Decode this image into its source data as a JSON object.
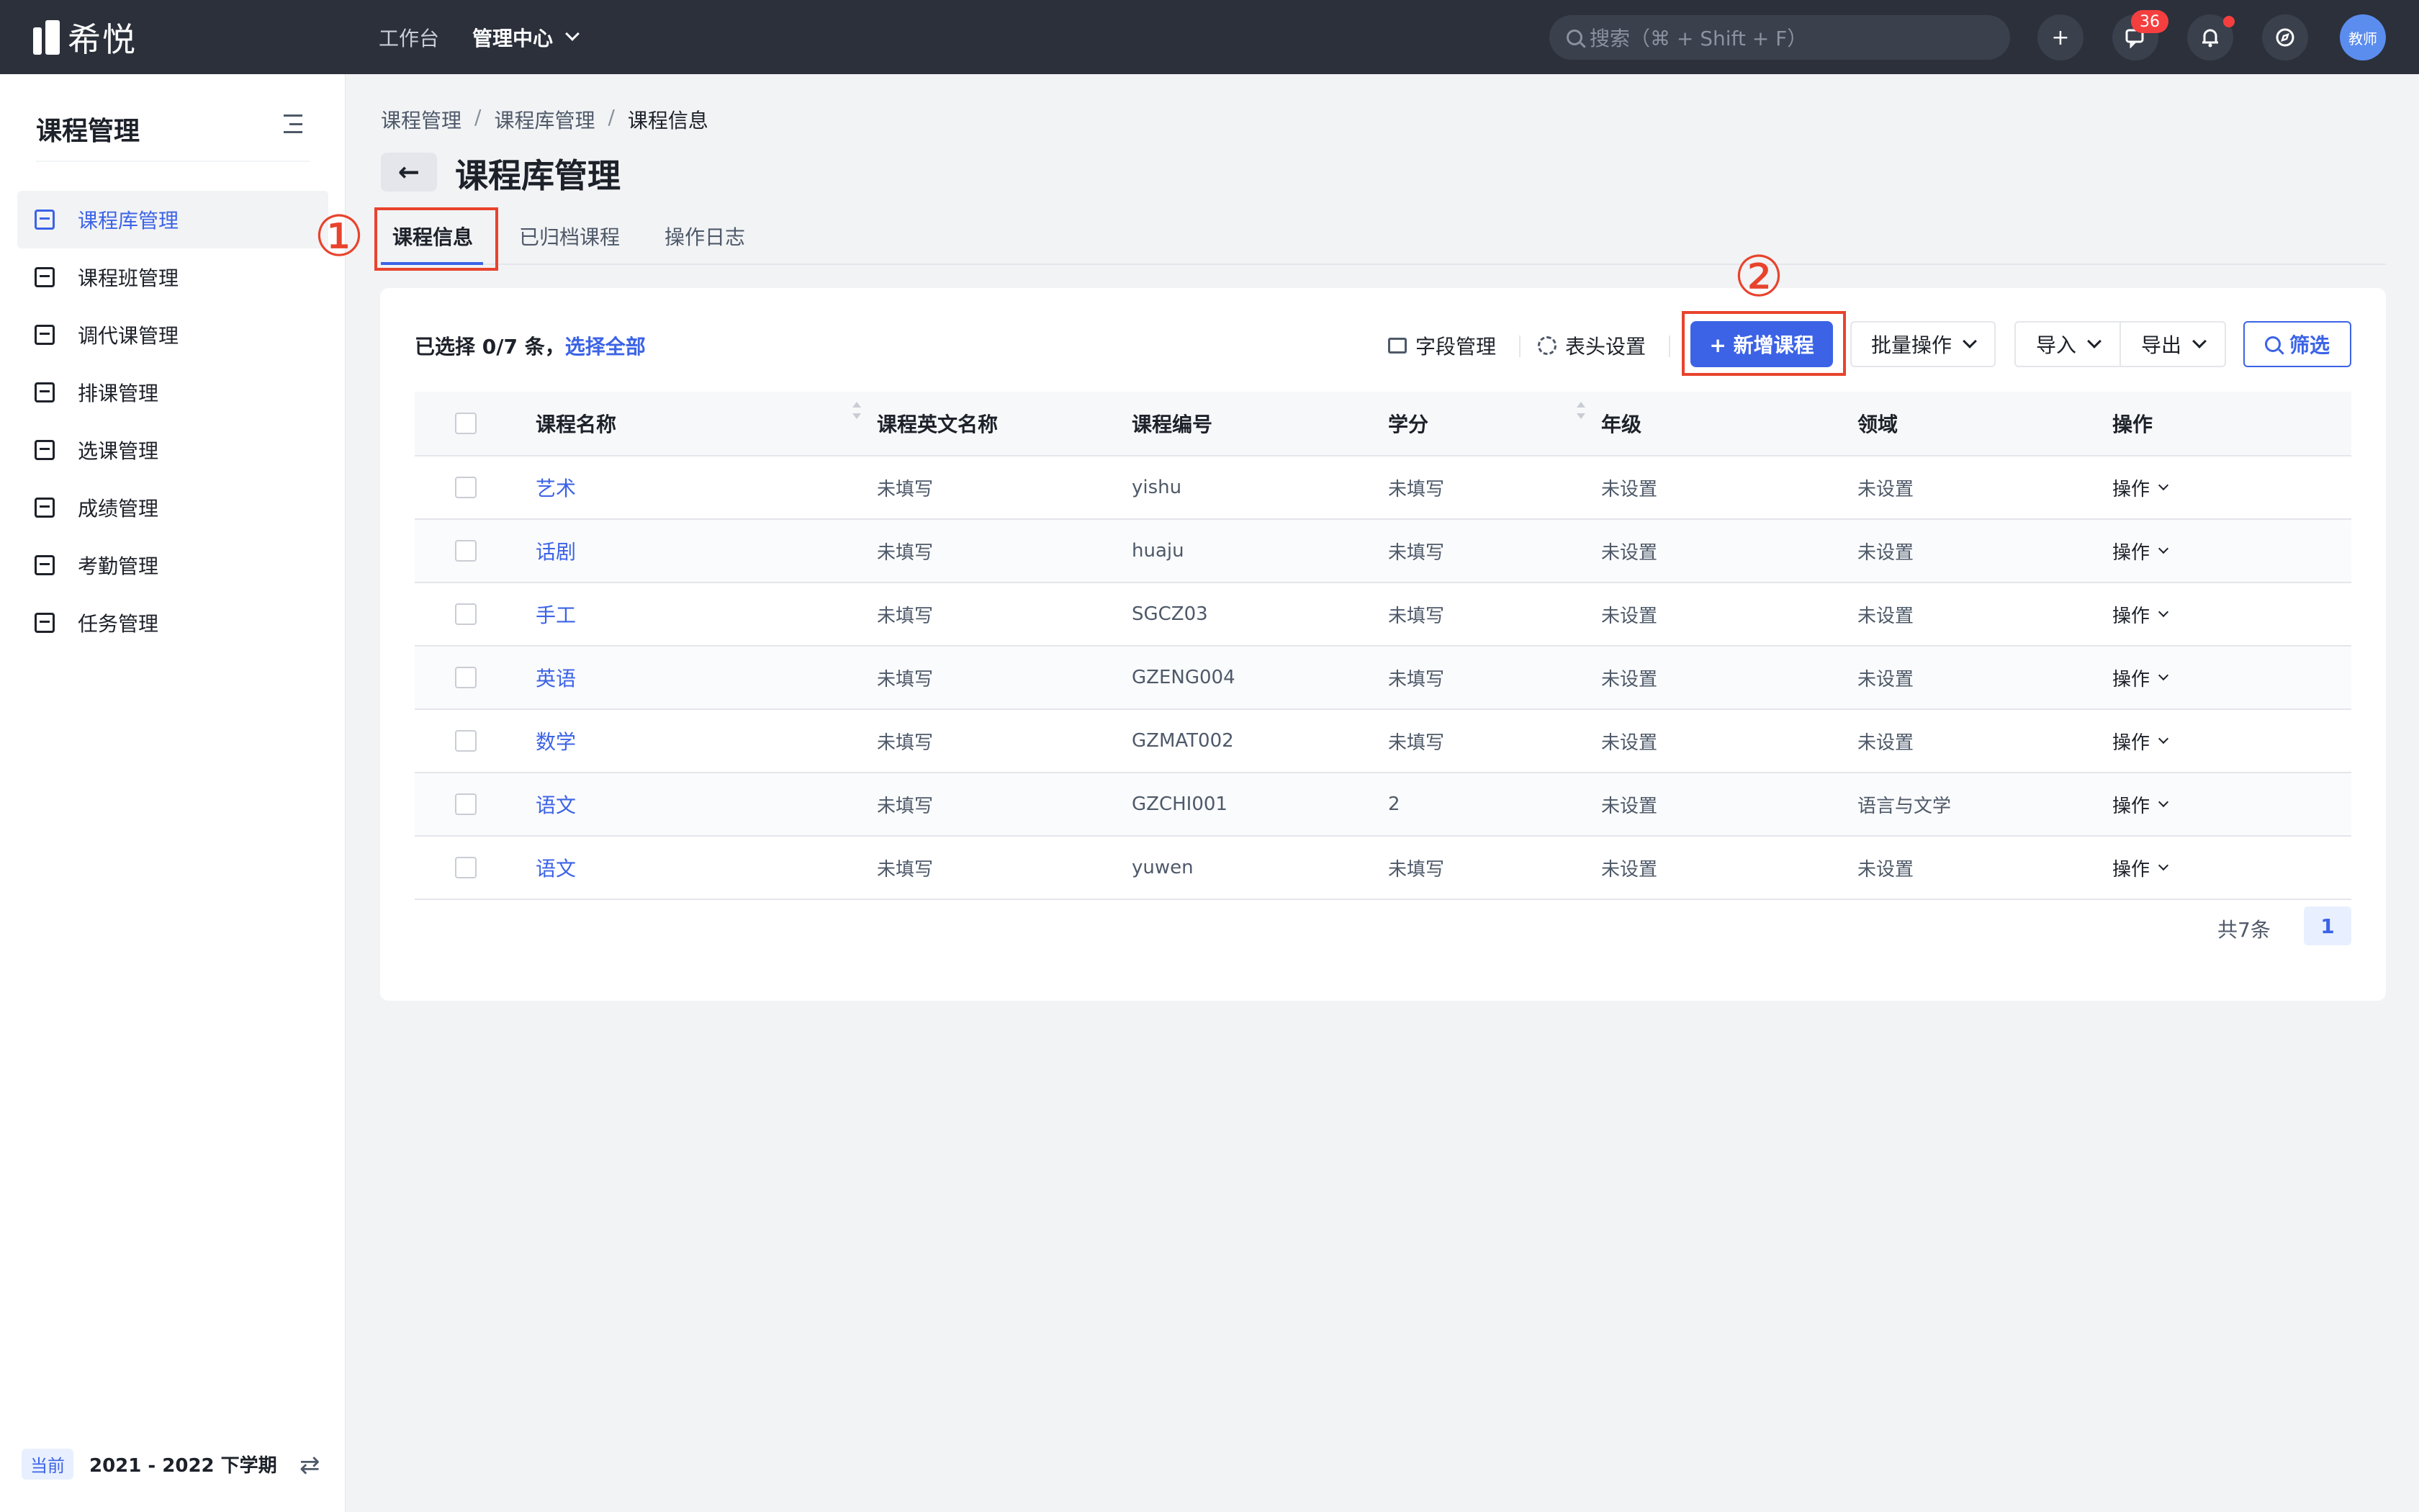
{
  "topbar": {
    "logo_text": "希悦",
    "nav": [
      {
        "label": "工作台"
      },
      {
        "label": "管理中心"
      }
    ],
    "search_placeholder": "搜索（⌘ + Shift + F）",
    "add_icon": "+",
    "message_count": "36",
    "avatar_label": "教师"
  },
  "sidebar": {
    "title": "课程管理",
    "items": [
      {
        "label": "课程库管理",
        "active": true
      },
      {
        "label": "课程班管理"
      },
      {
        "label": "调代课管理"
      },
      {
        "label": "排课管理"
      },
      {
        "label": "选课管理"
      },
      {
        "label": "成绩管理"
      },
      {
        "label": "考勤管理"
      },
      {
        "label": "任务管理"
      }
    ],
    "footer": {
      "current_label": "当前",
      "term": "2021 - 2022 下学期"
    }
  },
  "breadcrumb": [
    "课程管理",
    "课程库管理",
    "课程信息"
  ],
  "page_title": "课程库管理",
  "tabs": [
    {
      "label": "课程信息"
    },
    {
      "label": "已归档课程"
    },
    {
      "label": "操作日志"
    }
  ],
  "annotations": {
    "marker1": "①",
    "marker2": "②",
    "color": "#e8432d"
  },
  "toolbar": {
    "selection_text": "已选择 0/7 条，",
    "select_all": "选择全部",
    "field_manage": "字段管理",
    "header_settings": "表头设置",
    "add_course": "+ 新增课程",
    "batch_ops": "批量操作",
    "import": "导入",
    "export": "导出",
    "filter": "筛选"
  },
  "table": {
    "columns": [
      "课程名称",
      "课程英文名称",
      "课程编号",
      "学分",
      "年级",
      "领域",
      "操作"
    ],
    "rows": [
      {
        "name": "艺术",
        "en_name": "未填写",
        "code": "yishu",
        "credit": "未填写",
        "grade": "未设置",
        "field": "未设置",
        "action": "操作"
      },
      {
        "name": "话剧",
        "en_name": "未填写",
        "code": "huaju",
        "credit": "未填写",
        "grade": "未设置",
        "field": "未设置",
        "action": "操作"
      },
      {
        "name": "手工",
        "en_name": "未填写",
        "code": "SGCZ03",
        "credit": "未填写",
        "grade": "未设置",
        "field": "未设置",
        "action": "操作"
      },
      {
        "name": "英语",
        "en_name": "未填写",
        "code": "GZENG004",
        "credit": "未填写",
        "grade": "未设置",
        "field": "未设置",
        "action": "操作"
      },
      {
        "name": "数学",
        "en_name": "未填写",
        "code": "GZMAT002",
        "credit": "未填写",
        "grade": "未设置",
        "field": "未设置",
        "action": "操作"
      },
      {
        "name": "语文",
        "en_name": "未填写",
        "code": "GZCHI001",
        "credit": "2",
        "grade": "未设置",
        "field": "语言与文学",
        "action": "操作"
      },
      {
        "name": "语文",
        "en_name": "未填写",
        "code": "yuwen",
        "credit": "未填写",
        "grade": "未设置",
        "field": "未设置",
        "action": "操作"
      }
    ]
  },
  "pagination": {
    "total": "共7条",
    "current_page": "1"
  },
  "colors": {
    "primary": "#3c63e6",
    "topbar": "#2b303b",
    "badge": "#f53f3f"
  }
}
